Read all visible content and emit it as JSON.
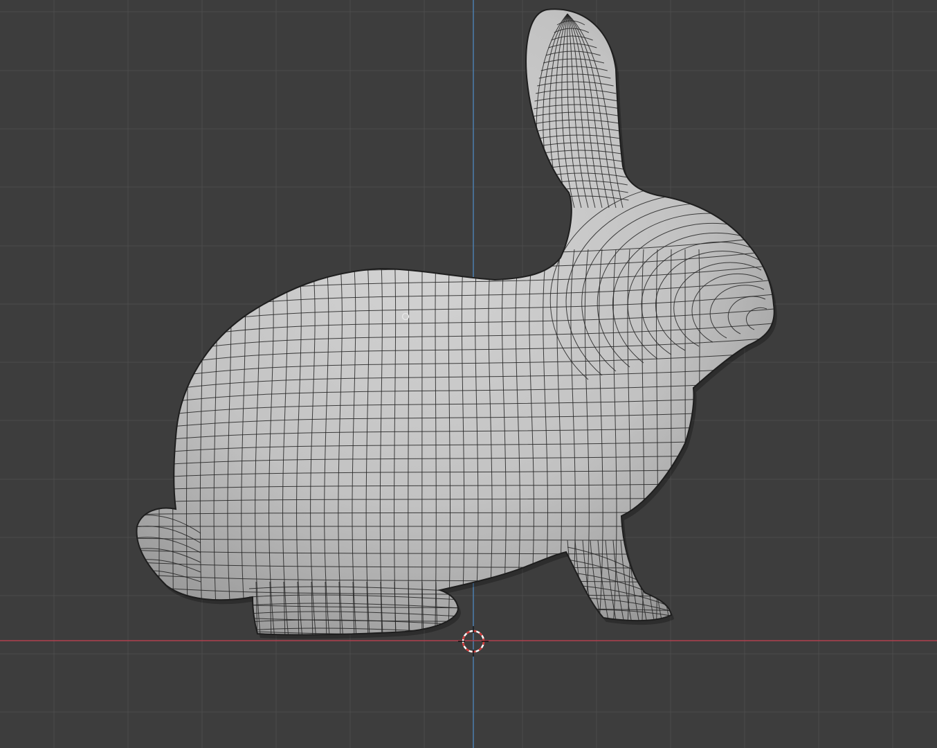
{
  "app": "3D viewport",
  "view": {
    "background_color": "#3d3d3d",
    "grid": true,
    "grid_color": "#4a4a4a",
    "x_axis_color": "#b0404e",
    "z_axis_color": "#4c7fae"
  },
  "object": {
    "name": "bunny",
    "shading": "solid",
    "wireframe_overlay": true,
    "surface_color": "#c9c9c9",
    "wire_color": "#222222"
  },
  "icons": {
    "cursor": "3d-cursor-icon",
    "origin": "object-origin-icon"
  }
}
